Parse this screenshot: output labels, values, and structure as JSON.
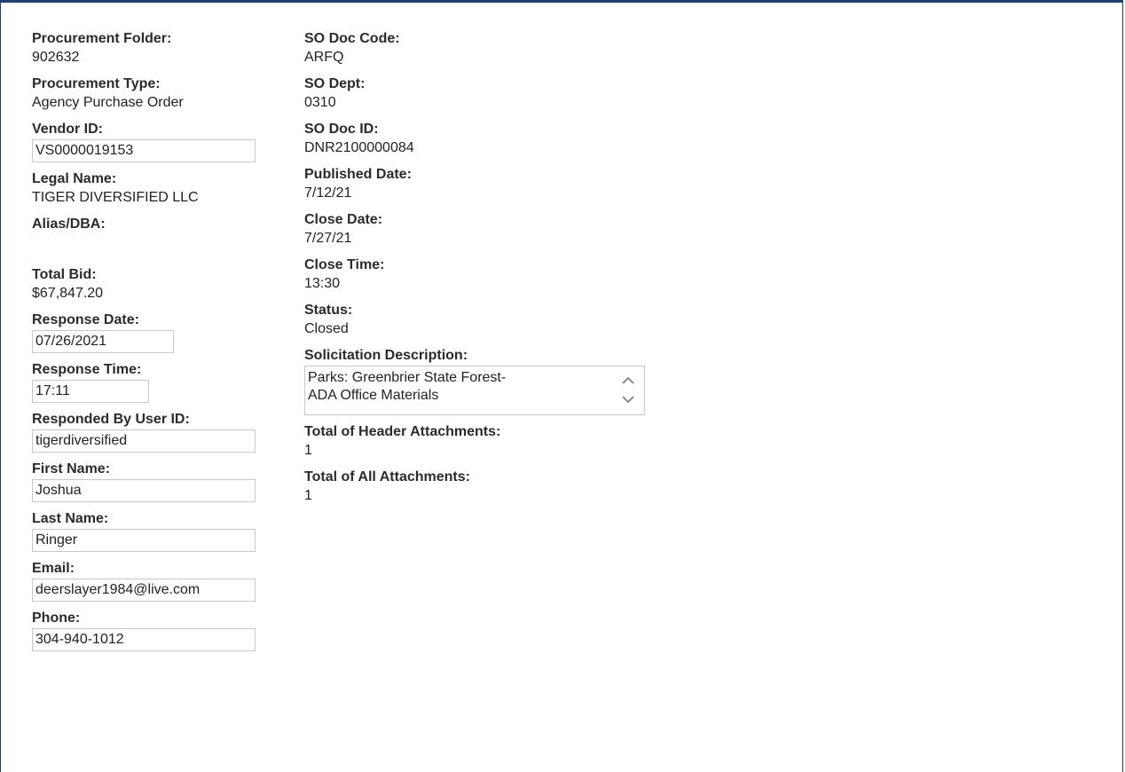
{
  "left": {
    "procurement_folder": {
      "label": "Procurement Folder:",
      "value": "902632"
    },
    "procurement_type": {
      "label": "Procurement Type:",
      "value": "Agency Purchase Order"
    },
    "vendor_id": {
      "label": "Vendor ID:",
      "value": "VS0000019153"
    },
    "legal_name": {
      "label": "Legal Name:",
      "value": "TIGER DIVERSIFIED LLC"
    },
    "alias_dba": {
      "label": "Alias/DBA:",
      "value": ""
    },
    "total_bid": {
      "label": "Total Bid:",
      "value": "$67,847.20"
    },
    "response_date": {
      "label": "Response Date:",
      "value": "07/26/2021"
    },
    "response_time": {
      "label": "Response Time:",
      "value": "17:11"
    },
    "responded_by": {
      "label": "Responded By User ID:",
      "value": "tigerdiversified"
    },
    "first_name": {
      "label": "First Name:",
      "value": "Joshua"
    },
    "last_name": {
      "label": "Last Name:",
      "value": "Ringer"
    },
    "email": {
      "label": "Email:",
      "value": "deerslayer1984@live.com"
    },
    "phone": {
      "label": "Phone:",
      "value": "304-940-1012"
    }
  },
  "right": {
    "so_doc_code": {
      "label": "SO Doc Code:",
      "value": "ARFQ"
    },
    "so_dept": {
      "label": "SO Dept:",
      "value": "0310"
    },
    "so_doc_id": {
      "label": "SO Doc ID:",
      "value": "DNR2100000084"
    },
    "published_date": {
      "label": "Published Date:",
      "value": "7/12/21"
    },
    "close_date": {
      "label": "Close Date:",
      "value": "7/27/21"
    },
    "close_time": {
      "label": "Close Time:",
      "value": "13:30"
    },
    "status": {
      "label": "Status:",
      "value": "Closed"
    },
    "solicitation_description": {
      "label": "Solicitation Description:",
      "line1": "Parks: Greenbrier State Forest-",
      "line2": "ADA Office Materials"
    },
    "total_header_attachments": {
      "label": "Total of Header Attachments:",
      "value": "1"
    },
    "total_all_attachments": {
      "label": "Total of All Attachments:",
      "value": "1"
    }
  },
  "icons": {
    "scroll_up": "chevron-up-icon",
    "scroll_down": "chevron-down-icon"
  },
  "colors": {
    "frame_border": "#1f3f73",
    "field_border": "#c8c8c8",
    "text": "#222222"
  }
}
